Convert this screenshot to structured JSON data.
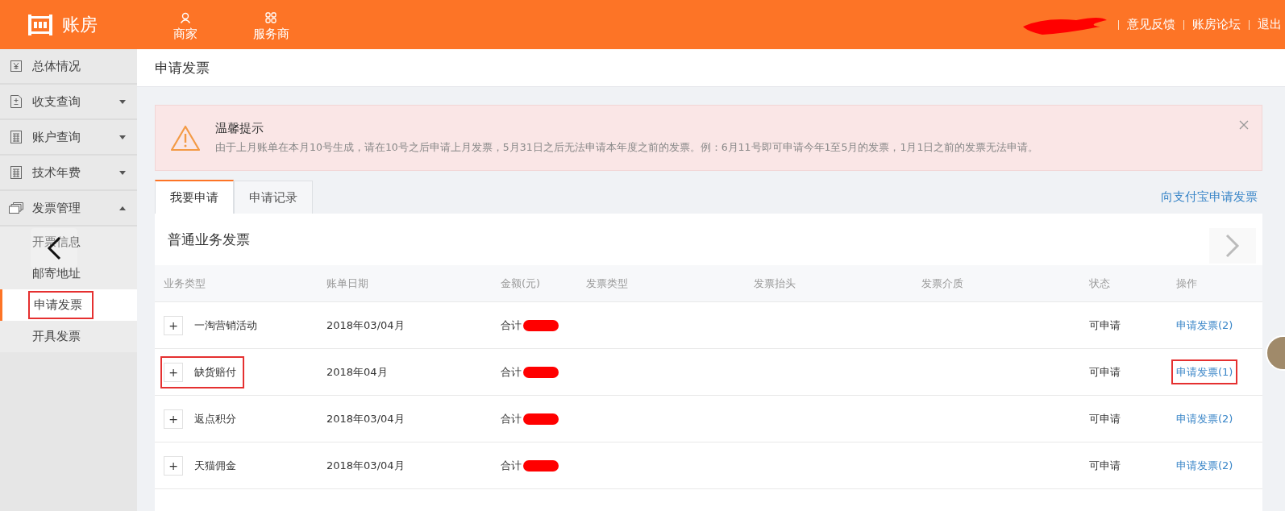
{
  "header": {
    "brand": "账房",
    "nav": [
      {
        "label": "商家",
        "kind": "person"
      },
      {
        "label": "服务商",
        "kind": "grid"
      }
    ],
    "user_redacted": true,
    "links": [
      "意见反馈",
      "账房论坛",
      "退出"
    ]
  },
  "sidebar": {
    "items": [
      {
        "label": "总体情况",
        "kind": "yen"
      },
      {
        "label": "收支查询",
        "kind": "doc",
        "expanded": false
      },
      {
        "label": "账户查询",
        "kind": "calc",
        "expanded": false
      },
      {
        "label": "技术年费",
        "kind": "calc",
        "expanded": false
      },
      {
        "label": "发票管理",
        "kind": "cards",
        "expanded": true,
        "children": [
          {
            "label": "开票信息",
            "selected": false,
            "highlighted": false
          },
          {
            "label": "邮寄地址",
            "selected": false,
            "highlighted": false
          },
          {
            "label": "申请发票",
            "selected": true,
            "highlighted": true
          },
          {
            "label": "开具发票",
            "selected": false,
            "highlighted": false
          }
        ]
      }
    ]
  },
  "page_title": "申请发票",
  "alert": {
    "title": "温馨提示",
    "message": "由于上月账单在本月10号生成，请在10号之后申请上月发票，5月31日之后无法申请本年度之前的发票。例：6月11号即可申请今年1至5月的发票，1月1日之前的发票无法申请。"
  },
  "tabs": [
    {
      "label": "我要申请",
      "selected": true
    },
    {
      "label": "申请记录",
      "selected": false
    }
  ],
  "alipay_link": "向支付宝申请发票",
  "section_title": "普通业务发票",
  "table": {
    "columns": [
      "业务类型",
      "账单日期",
      "金额(元)",
      "发票类型",
      "发票抬头",
      "发票介质",
      "状态",
      "操作"
    ],
    "rows": [
      {
        "expand": "+",
        "name": "一淘营销活动",
        "name_highlighted": false,
        "date": "2018年03/04月",
        "amount_label": "合计",
        "status": "可申请",
        "action": "申请发票(2)",
        "action_highlighted": false
      },
      {
        "expand": "+",
        "name": "缺货赔付",
        "name_highlighted": true,
        "date": "2018年04月",
        "amount_label": "合计",
        "status": "可申请",
        "action": "申请发票(1)",
        "action_highlighted": true
      },
      {
        "expand": "+",
        "name": "返点积分",
        "name_highlighted": false,
        "date": "2018年03/04月",
        "amount_label": "合计",
        "status": "可申请",
        "action": "申请发票(2)",
        "action_highlighted": false
      },
      {
        "expand": "+",
        "name": "天猫佣金",
        "name_highlighted": false,
        "date": "2018年03/04月",
        "amount_label": "合计",
        "status": "可申请",
        "action": "申请发票(2)",
        "action_highlighted": false
      }
    ]
  }
}
